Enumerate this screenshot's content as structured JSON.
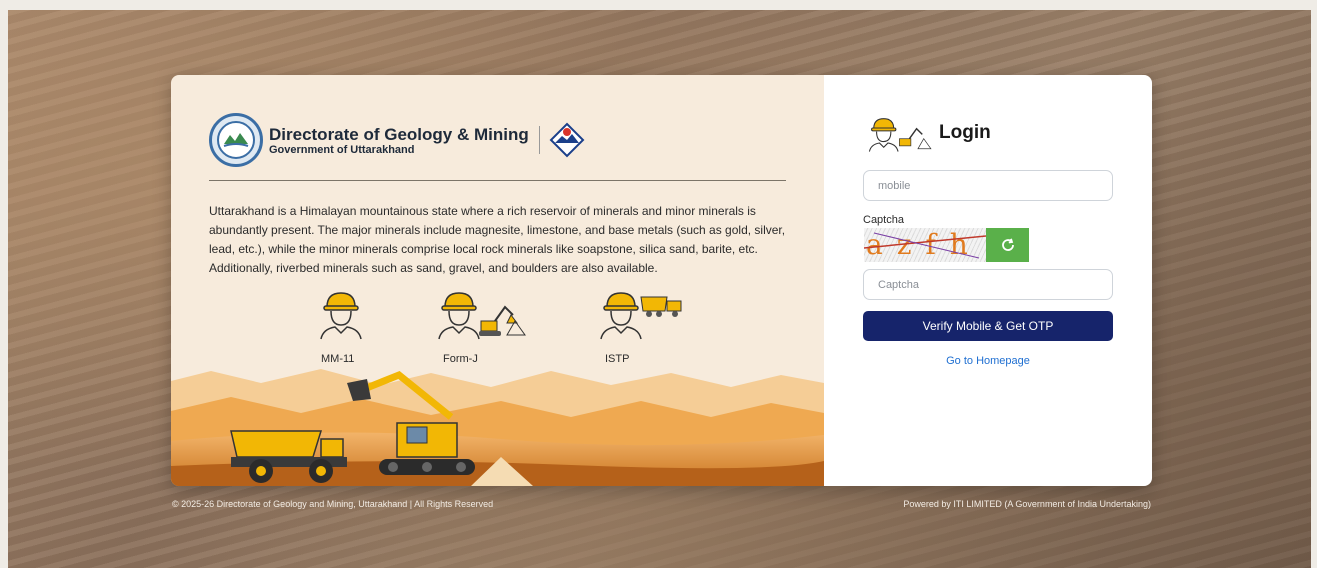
{
  "brand": {
    "title": "Directorate of Geology & Mining",
    "subtitle": "Government of Uttarakhand"
  },
  "description": "Uttarakhand is a Himalayan mountainous state where a rich reservoir of minerals and minor minerals is abundantly present. The major minerals include magnesite, limestone, and base metals (such as gold, silver, lead, etc.), while the minor minerals comprise local rock minerals like soapstone, silica sand, barite, etc. Additionally, riverbed minerals such as sand, gravel, and boulders are also available.",
  "roles": [
    {
      "label": "MM-11",
      "icon": "worker-icon"
    },
    {
      "label": "Form-J",
      "icon": "worker-excavator-icon"
    },
    {
      "label": "ISTP",
      "icon": "worker-truck-icon"
    }
  ],
  "login": {
    "title": "Login",
    "mobile_placeholder": "mobile",
    "captcha_label": "Captcha",
    "captcha_text": "azfh",
    "captcha_placeholder": "Captcha",
    "verify_button": "Verify Mobile & Get OTP",
    "home_link": "Go to Homepage"
  },
  "footer": {
    "copyright": "© 2025-26 Directorate of Geology and Mining, Uttarakhand | All Rights Reserved",
    "powered_by": "Powered by ITI LIMITED (A Government of India Undertaking)"
  },
  "colors": {
    "primary_button": "#16246b",
    "refresh_button": "#5ab04a",
    "link": "#1f6fd1",
    "panel_left": "#f7ebdc"
  }
}
